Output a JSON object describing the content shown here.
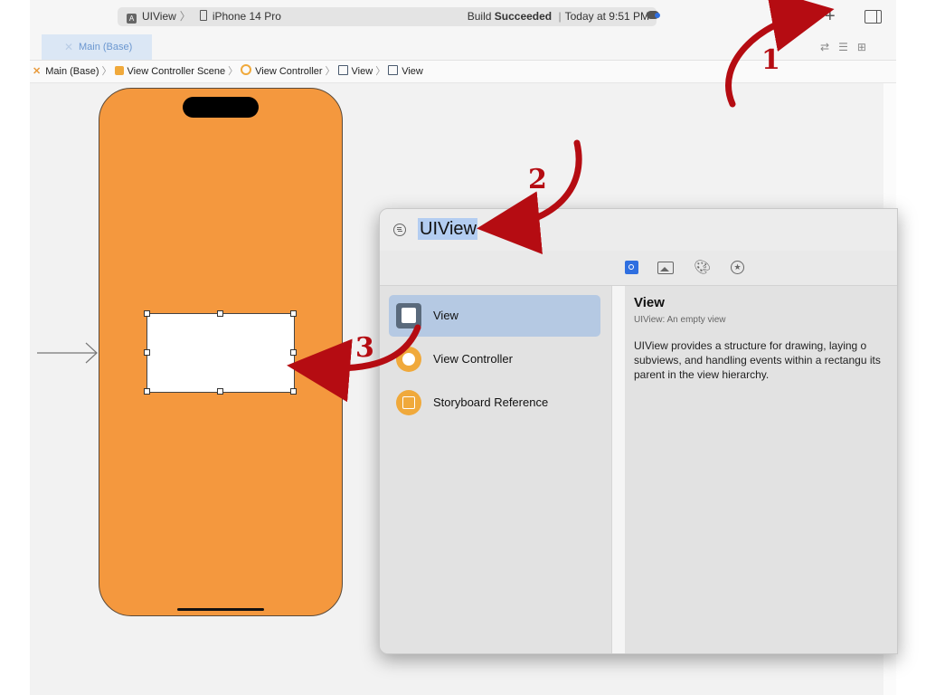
{
  "toolbar": {
    "scheme_app": "UIView",
    "scheme_device": "iPhone 14 Pro",
    "status_prefix": "Build",
    "status_bold": "Succeeded",
    "status_time": "Today at 9:51 PM",
    "plus_label": "+"
  },
  "tab": {
    "label": "Main (Base)",
    "close": "✕"
  },
  "jumpbar": {
    "items": [
      "Main (Base)",
      "View Controller Scene",
      "View Controller",
      "View",
      "View"
    ]
  },
  "library": {
    "search_value": "UIView",
    "items": [
      {
        "label": "View",
        "icon": "view-icon",
        "selected": true
      },
      {
        "label": "View Controller",
        "icon": "view-controller-icon",
        "selected": false
      },
      {
        "label": "Storyboard Reference",
        "icon": "storyboard-reference-icon",
        "selected": false
      }
    ],
    "segments": [
      "objects-icon",
      "media-icon",
      "colors-icon",
      "snippets-icon"
    ],
    "detail": {
      "title": "View",
      "subtitle": "UIView: An empty view",
      "description": "UIView provides a structure for drawing, laying o subviews, and handling events within a rectangu its parent in the view hierarchy."
    }
  },
  "annotations": {
    "step1": "1",
    "step2": "2",
    "step3": "3",
    "arrow_color": "#b50c12"
  },
  "colors": {
    "phone_fill": "#f4983e",
    "selection": "#b5c9e3",
    "accent": "#2f6fe0"
  }
}
